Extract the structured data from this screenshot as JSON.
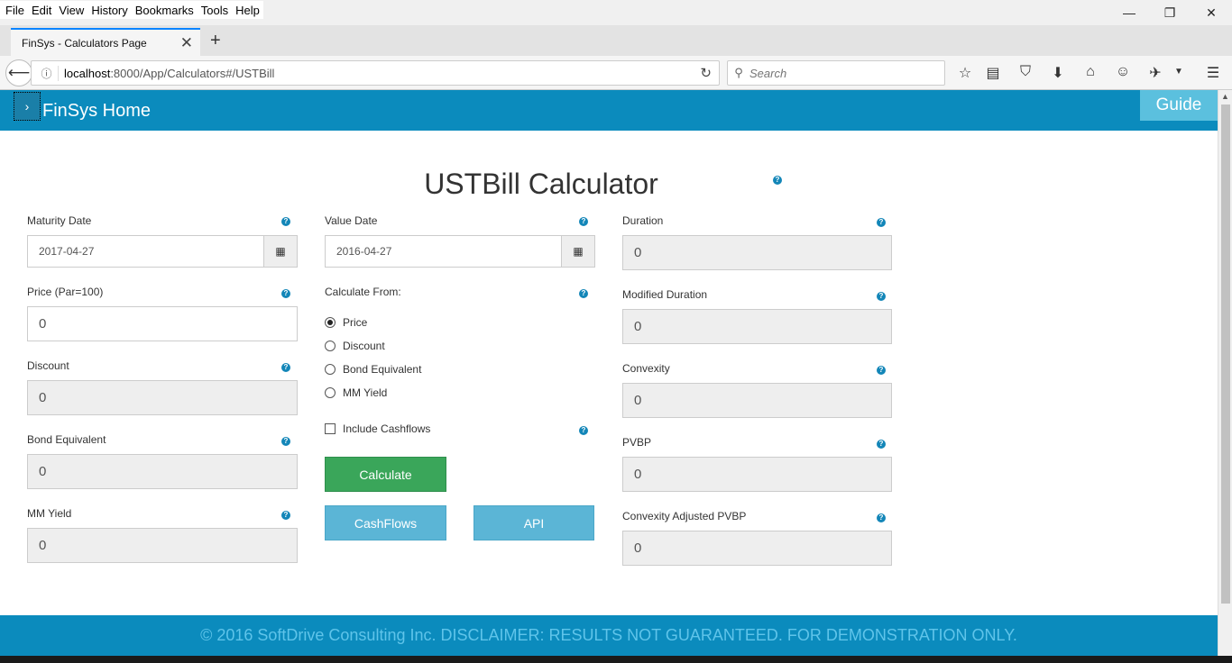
{
  "menubar": {
    "items": [
      "File",
      "Edit",
      "View",
      "History",
      "Bookmarks",
      "Tools",
      "Help"
    ]
  },
  "window": {
    "minimize": "—",
    "restore": "❐",
    "close": "✕"
  },
  "tab": {
    "title": "FinSys - Calculators Page",
    "close": "✕",
    "new_tab": "+"
  },
  "navbar": {
    "url_host": "localhost",
    "url_rest": ":8000/App/Calculators#/USTBill",
    "search_placeholder": "Search"
  },
  "app": {
    "brand": "FinSys Home",
    "toggle": "›",
    "guide": "Guide",
    "title": "USTBill Calculator",
    "footer": "© 2016 SoftDrive Consulting Inc. DISCLAIMER: RESULTS NOT GUARANTEED. FOR DEMONSTRATION ONLY."
  },
  "left": {
    "maturity_label": "Maturity Date",
    "maturity_value": "2017-04-27",
    "price_label": "Price (Par=100)",
    "price_value": "0",
    "discount_label": "Discount",
    "discount_value": "0",
    "bond_label": "Bond Equivalent",
    "bond_value": "0",
    "mm_label": "MM Yield",
    "mm_value": "0"
  },
  "middle": {
    "value_date_label": "Value Date",
    "value_date_value": "2016-04-27",
    "calc_from_label": "Calculate From:",
    "options": [
      "Price",
      "Discount",
      "Bond Equivalent",
      "MM Yield"
    ],
    "selected": "Price",
    "include_cashflows": "Include Cashflows",
    "calculate": "Calculate",
    "cashflows": "CashFlows",
    "api": "API"
  },
  "right": {
    "duration_label": "Duration",
    "duration_value": "0",
    "mod_duration_label": "Modified Duration",
    "mod_duration_value": "0",
    "convexity_label": "Convexity",
    "convexity_value": "0",
    "pvbp_label": "PVBP",
    "pvbp_value": "0",
    "cpvbp_label": "Convexity Adjusted PVBP",
    "cpvbp_value": "0"
  },
  "help_glyph": "?",
  "calendar_glyph": "▦"
}
